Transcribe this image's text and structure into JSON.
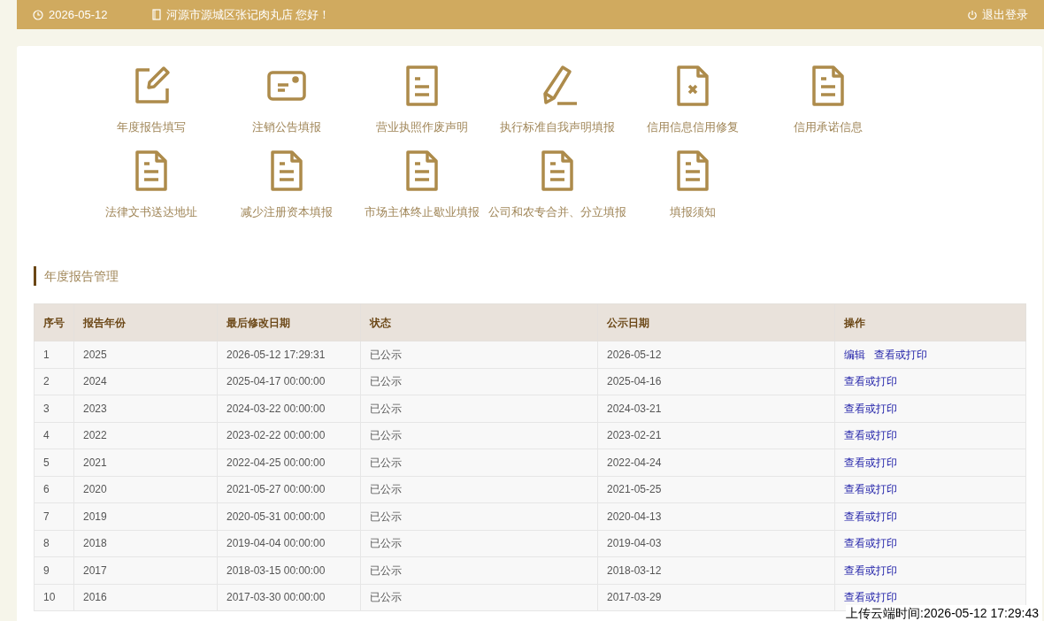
{
  "header": {
    "date": "2026-05-12",
    "greeting": "河源市源城区张记肉丸店 您好！",
    "logout": "退出登录"
  },
  "shortcuts": [
    {
      "label": "年度报告填写",
      "kind": "edit"
    },
    {
      "label": "注销公告填报",
      "kind": "card"
    },
    {
      "label": "营业执照作废声明",
      "kind": "doc"
    },
    {
      "label": "执行标准自我声明填报",
      "kind": "pencil"
    },
    {
      "label": "信用信息信用修复",
      "kind": "docx"
    },
    {
      "label": "信用承诺信息",
      "kind": "docfold"
    },
    {
      "label": "法律文书送达地址",
      "kind": "docfold"
    },
    {
      "label": "减少注册资本填报",
      "kind": "docfold"
    },
    {
      "label": "市场主体终止歇业填报",
      "kind": "docfold"
    },
    {
      "label": "公司和农专合并、分立填报",
      "kind": "docfold"
    },
    {
      "label": "填报须知",
      "kind": "docfold"
    }
  ],
  "section_title": "年度报告管理",
  "table": {
    "columns": [
      "序号",
      "报告年份",
      "最后修改日期",
      "状态",
      "公示日期",
      "操作"
    ],
    "rows": [
      {
        "cells": [
          "1",
          "2025",
          "2026-05-12 17:29:31",
          "已公示",
          "2026-05-12"
        ],
        "actions": [
          "编辑",
          "查看或打印"
        ]
      },
      {
        "cells": [
          "2",
          "2024",
          "2025-04-17 00:00:00",
          "已公示",
          "2025-04-16"
        ],
        "actions": [
          "查看或打印"
        ]
      },
      {
        "cells": [
          "3",
          "2023",
          "2024-03-22 00:00:00",
          "已公示",
          "2024-03-21"
        ],
        "actions": [
          "查看或打印"
        ]
      },
      {
        "cells": [
          "4",
          "2022",
          "2023-02-22 00:00:00",
          "已公示",
          "2023-02-21"
        ],
        "actions": [
          "查看或打印"
        ]
      },
      {
        "cells": [
          "5",
          "2021",
          "2022-04-25 00:00:00",
          "已公示",
          "2022-04-24"
        ],
        "actions": [
          "查看或打印"
        ]
      },
      {
        "cells": [
          "6",
          "2020",
          "2021-05-27 00:00:00",
          "已公示",
          "2021-05-25"
        ],
        "actions": [
          "查看或打印"
        ]
      },
      {
        "cells": [
          "7",
          "2019",
          "2020-05-31 00:00:00",
          "已公示",
          "2020-04-13"
        ],
        "actions": [
          "查看或打印"
        ]
      },
      {
        "cells": [
          "8",
          "2018",
          "2019-04-04 00:00:00",
          "已公示",
          "2019-04-03"
        ],
        "actions": [
          "查看或打印"
        ]
      },
      {
        "cells": [
          "9",
          "2017",
          "2018-03-15 00:00:00",
          "已公示",
          "2018-03-12"
        ],
        "actions": [
          "查看或打印"
        ]
      },
      {
        "cells": [
          "10",
          "2016",
          "2017-03-30 00:00:00",
          "已公示",
          "2017-03-29"
        ],
        "actions": [
          "查看或打印"
        ]
      }
    ]
  },
  "upload_stamp": "上传云端时间:2026-05-12 17:29:43"
}
